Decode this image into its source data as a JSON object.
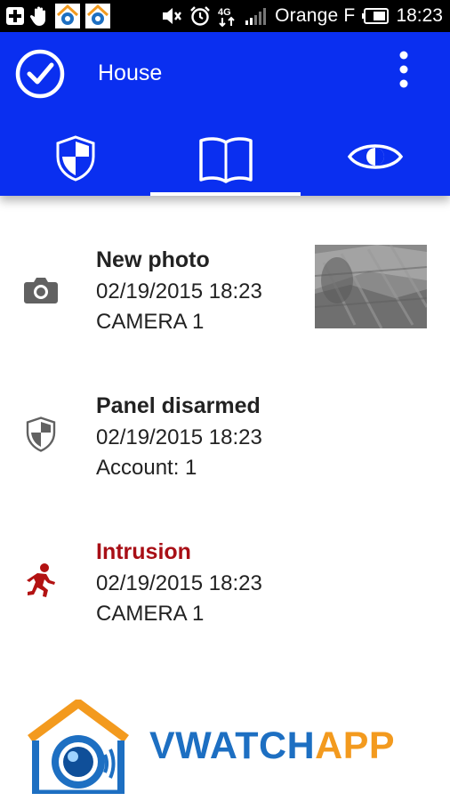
{
  "status_bar": {
    "carrier": "Orange F",
    "time": "18:23",
    "network_label": "4G"
  },
  "app_bar": {
    "title": "House",
    "colors": {
      "bar": "#0a2ff0",
      "icon": "#ffffff"
    },
    "tabs": [
      {
        "icon": "shield-icon",
        "selected": false
      },
      {
        "icon": "book-icon",
        "selected": true
      },
      {
        "icon": "eye-icon",
        "selected": false
      }
    ]
  },
  "events": [
    {
      "icon": "camera-icon",
      "title": "New photo",
      "datetime": "02/19/2015 18:23",
      "detail": "CAMERA 1",
      "has_thumbnail": true
    },
    {
      "icon": "shield-icon",
      "title": "Panel disarmed",
      "datetime": "02/19/2015 18:23",
      "detail": "Account: 1",
      "has_thumbnail": false
    },
    {
      "icon": "intruder-icon",
      "title": "Intrusion",
      "datetime": "02/19/2015 18:23",
      "detail": "CAMERA 1",
      "has_thumbnail": false,
      "title_color": "#a80f16"
    }
  ],
  "branding": {
    "text_blue": "VWATCH",
    "text_orange": "APP",
    "colors": {
      "blue": "#1d6fc2",
      "orange": "#f39a1e"
    }
  }
}
